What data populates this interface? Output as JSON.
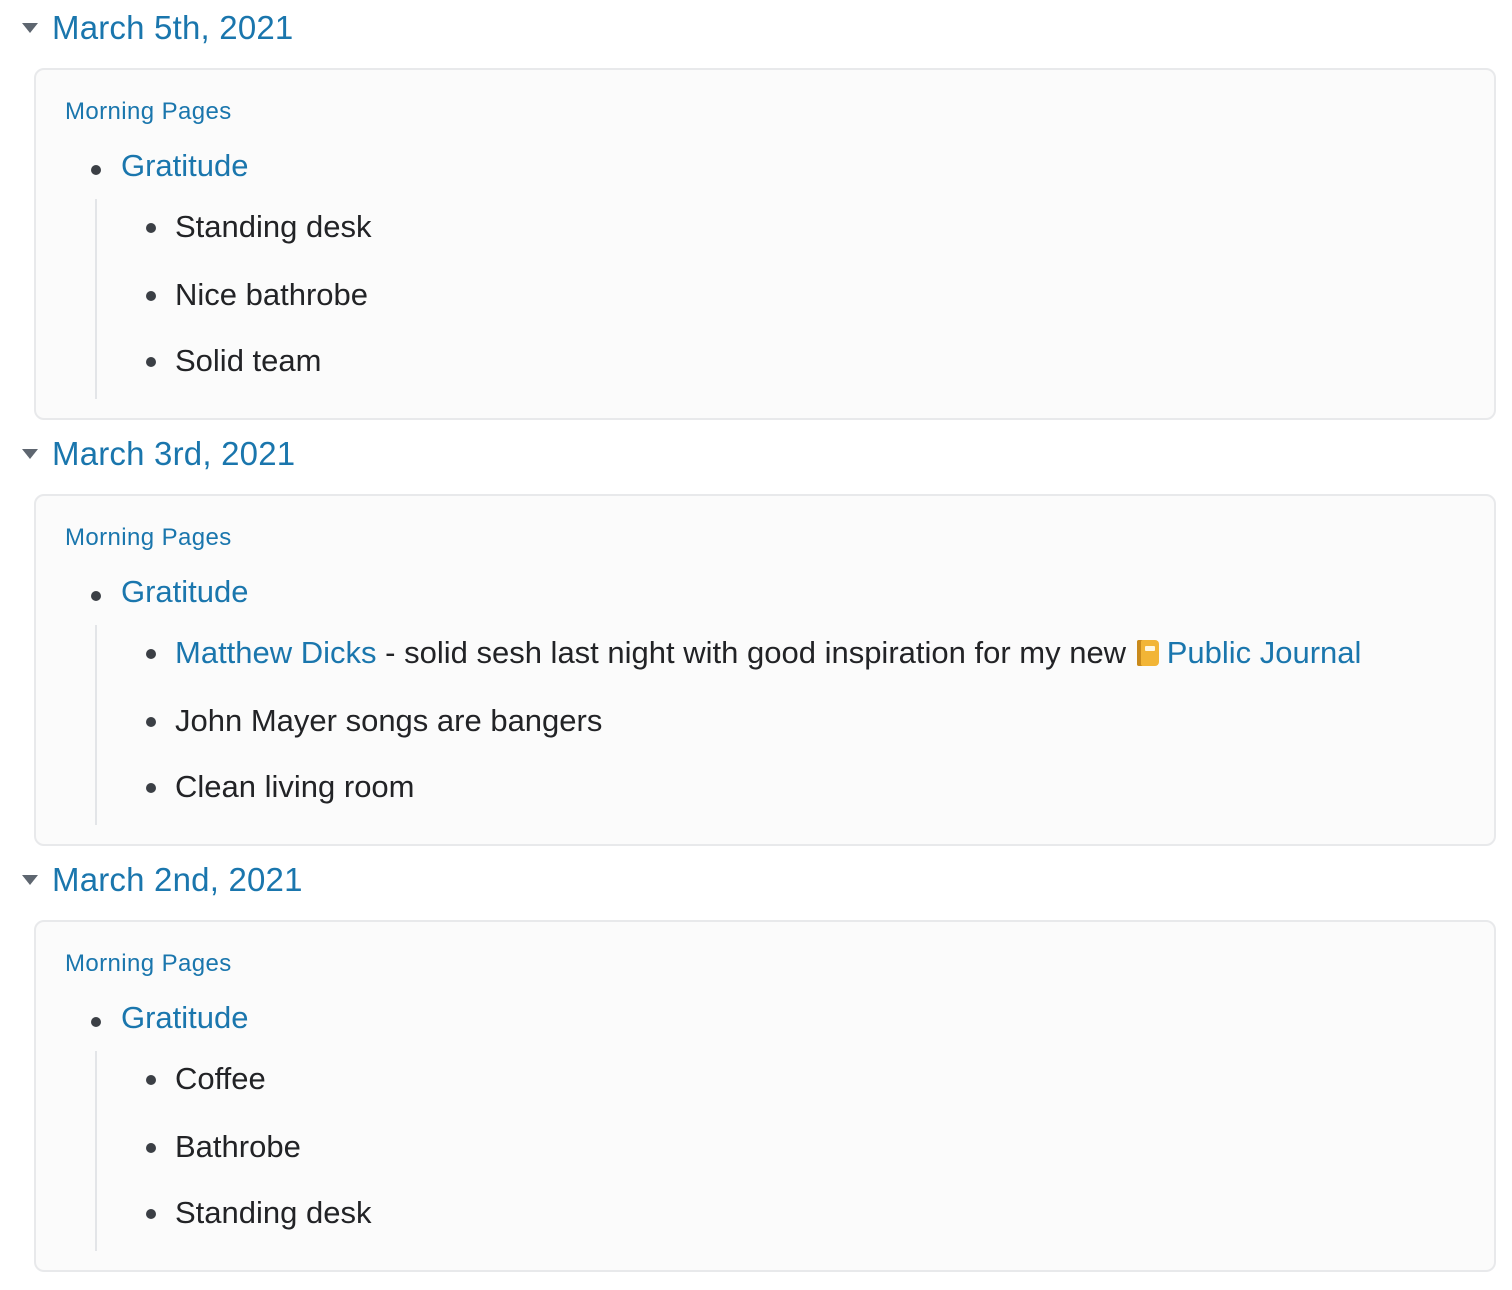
{
  "colors": {
    "link": "#1a76ad",
    "text": "#222326",
    "card_background": "#fbfbfb",
    "card_border": "#e8e9eb",
    "caret": "#5e6670"
  },
  "entries": [
    {
      "date": "March 5th, 2021",
      "page_ref": "Morning Pages",
      "parent": "Gratitude",
      "children": [
        "Standing desk",
        "Nice bathrobe",
        "Solid team"
      ]
    },
    {
      "date": "March 3rd, 2021",
      "page_ref": "Morning Pages",
      "parent": "Gratitude",
      "children": [
        {
          "link": "Matthew Dicks",
          "text": " - solid sesh last night with good inspiration for my new ",
          "icon": "journal-icon",
          "link2": "Public Journal"
        },
        "John Mayer songs are bangers",
        "Clean living room"
      ]
    },
    {
      "date": "March 2nd, 2021",
      "page_ref": "Morning Pages",
      "parent": "Gratitude",
      "children": [
        "Coffee",
        "Bathrobe",
        "Standing desk"
      ]
    }
  ]
}
